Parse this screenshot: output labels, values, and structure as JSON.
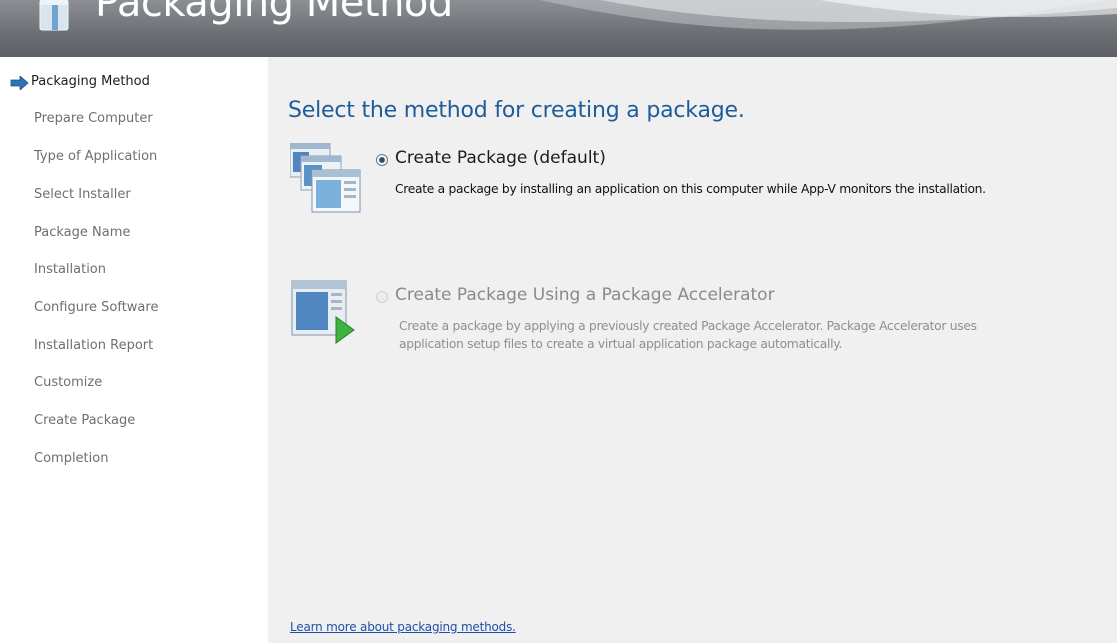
{
  "header": {
    "title": "Packaging Method",
    "icon": "package-box-icon"
  },
  "sidebar": {
    "active_icon": "arrow-right-icon",
    "items": [
      {
        "label": "Packaging Method",
        "active": true
      },
      {
        "label": "Prepare Computer"
      },
      {
        "label": "Type of Application"
      },
      {
        "label": "Select Installer"
      },
      {
        "label": "Package Name"
      },
      {
        "label": "Installation"
      },
      {
        "label": "Configure Software"
      },
      {
        "label": "Installation Report"
      },
      {
        "label": "Customize"
      },
      {
        "label": "Create Package"
      },
      {
        "label": "Completion"
      }
    ]
  },
  "main": {
    "heading": "Select the method for creating a package.",
    "options": [
      {
        "title": "Create Package (default)",
        "description": "Create a package by installing an application on this computer while App-V monitors the installation.",
        "selected": true,
        "enabled": true,
        "icon": "create-package-windows-icon"
      },
      {
        "title": "Create Package Using a Package Accelerator",
        "description_line1": "Create a package by applying a previously created Package Accelerator. Package Accelerator uses",
        "description_line2": "application setup files to create a virtual application package automatically.",
        "selected": false,
        "enabled": false,
        "icon": "package-accelerator-icon"
      }
    ],
    "learn_more_link": "Learn more about packaging methods."
  },
  "colors": {
    "heading": "#1e5c9a",
    "link": "#1f4fa8",
    "arrow": "#2e73b8",
    "banner": "#6d7175",
    "main_bg": "#f0f0f0"
  }
}
